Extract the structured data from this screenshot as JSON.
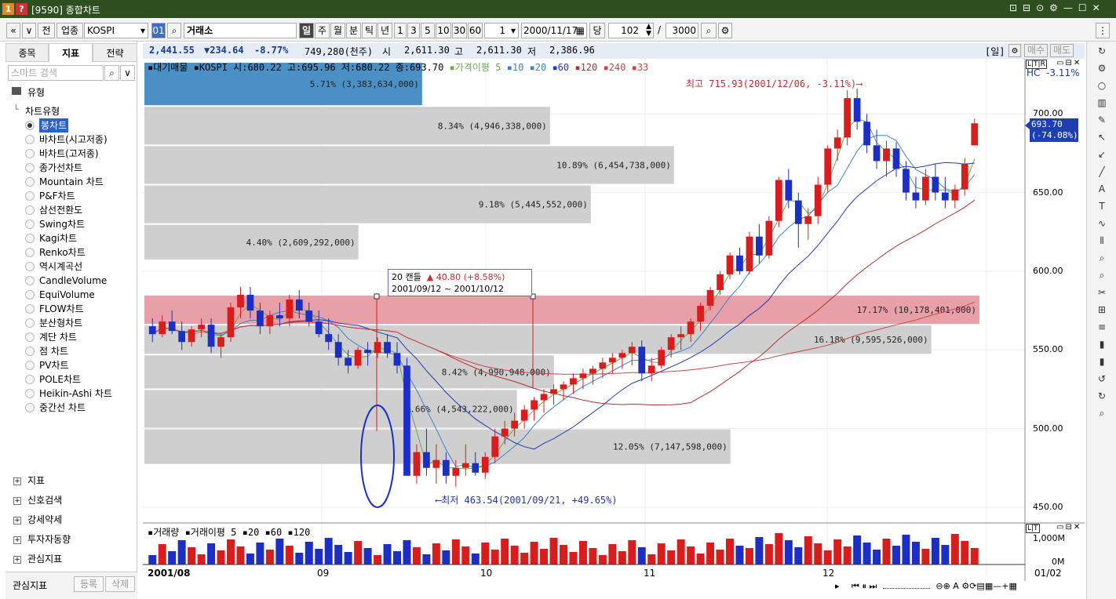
{
  "window": {
    "title": "[9590] 종합차트",
    "icons": [
      "1",
      "?"
    ]
  },
  "toolbar": {
    "nav_prev": "«",
    "nav_down": "»",
    "jeon": "전",
    "category": "업종",
    "symbol": "KOSPI",
    "code": "01",
    "market": "거래소",
    "periods": [
      "일",
      "주",
      "월",
      "분",
      "틱",
      "년"
    ],
    "active_period": "일",
    "intervals": [
      "1",
      "3",
      "5",
      "10",
      "30",
      "60"
    ],
    "count_select": "1",
    "date": "2000/11/17",
    "dang": "당",
    "bars": "102",
    "slash": "/",
    "total": "3000"
  },
  "left_tabs": [
    "종목",
    "지표",
    "전략"
  ],
  "active_left_tab": "지표",
  "search_placeholder": "스마트 검색",
  "tree": {
    "root": "유형",
    "group": "차트유형",
    "items": [
      "봉차트",
      "바차트(시고저종)",
      "바차트(고저종)",
      "종가선차트",
      "Mountain 차트",
      "P&F차트",
      "삼선전환도",
      "Swing차트",
      "Kagi차트",
      "Renko차트",
      "역시계곡선",
      "CandleVolume",
      "EquiVolume",
      "FLOW차트",
      "분산형차트",
      "계단 차트",
      "점 차트",
      "PV차트",
      "POLE차트",
      "Heikin-Ashi 차트",
      "중간선 차트"
    ],
    "selected": "봉차트"
  },
  "sections": [
    "지표",
    "신호검색",
    "강세약세",
    "투자자동향",
    "관심지표"
  ],
  "bottom_left": {
    "label": "관심지표",
    "register": "등록",
    "delete": "삭제"
  },
  "infobar": {
    "price": "2,441.55",
    "change": "▼234.64",
    "pct": "-8.77%",
    "volume": "749,280(천주)",
    "open_label": "시",
    "open": "2,611.30",
    "high_label": "고",
    "high": "2,611.30",
    "low_label": "저",
    "low": "2,386.96",
    "period_tag": "[일]",
    "buy": "매수",
    "sell": "매도"
  },
  "legend": {
    "main": "▪대기매물 ▪KOSPI 시:680.22 고:695.96 저:680.22 종:693.70",
    "ma_label": "▪가격이평 5",
    "ma_items": [
      "10",
      "20",
      "60",
      "120",
      "240",
      "33"
    ],
    "ma_colors": [
      "#6aa84f",
      "#3d85c6",
      "#3d85c6",
      "#1f3bb3",
      "#b03030",
      "#cc4444",
      "#cc4444"
    ]
  },
  "price_axis": {
    "labels": [
      "700.00",
      "650.00",
      "600.00",
      "550.00",
      "500.00",
      "450.00"
    ],
    "hc": "HC",
    "hc_pct": "-3.11%",
    "current": "693.70",
    "current_pct": "(-74.08%)"
  },
  "annotations": {
    "high": "최고 715.93(2001/12/06, -3.11%)⟶",
    "low": "⟵최저 463.54(2001/09/21, +49.65%)",
    "box_line1": "20 캔들",
    "box_change": "▲ 40.80 (+8.58%)",
    "box_line2": "2001/09/12 ~ 2001/10/12"
  },
  "chart_data": {
    "type": "volume_profile_candlestick",
    "profile": [
      {
        "label": "5.71% (3,383,634,000)",
        "pct": 5.71
      },
      {
        "label": "8.34% (4,946,338,000)",
        "pct": 8.34
      },
      {
        "label": "10.89% (6,454,738,000)",
        "pct": 10.89
      },
      {
        "label": "9.18% (5,445,552,000)",
        "pct": 9.18
      },
      {
        "label": "4.40% (2,609,292,000)",
        "pct": 4.4
      },
      {
        "label": "17.17% (10,178,401,000)",
        "pct": 17.17
      },
      {
        "label": "16.18% (9,595,526,000)",
        "pct": 16.18
      },
      {
        "label": "8.42% (4,990,948,000)",
        "pct": 8.42
      },
      {
        "label": "7.66% (4,543,222,000)",
        "pct": 7.66
      },
      {
        "label": "12.05% (7,147,598,000)",
        "pct": 12.05
      }
    ],
    "ylim": [
      450,
      720
    ],
    "x_labels": [
      "2001/08",
      "09",
      "10",
      "11",
      "12",
      "01/02"
    ],
    "candles": [
      [
        565,
        570,
        555,
        560
      ],
      [
        560,
        572,
        558,
        568
      ],
      [
        568,
        575,
        560,
        562
      ],
      [
        562,
        568,
        550,
        555
      ],
      [
        555,
        565,
        552,
        563
      ],
      [
        563,
        570,
        558,
        566
      ],
      [
        566,
        570,
        548,
        552
      ],
      [
        552,
        560,
        545,
        558
      ],
      [
        558,
        580,
        555,
        577
      ],
      [
        577,
        590,
        570,
        585
      ],
      [
        585,
        590,
        570,
        575
      ],
      [
        575,
        580,
        560,
        565
      ],
      [
        565,
        575,
        560,
        572
      ],
      [
        572,
        580,
        565,
        570
      ],
      [
        570,
        585,
        565,
        582
      ],
      [
        582,
        588,
        570,
        575
      ],
      [
        575,
        580,
        565,
        568
      ],
      [
        568,
        575,
        558,
        560
      ],
      [
        560,
        570,
        550,
        555
      ],
      [
        555,
        560,
        540,
        545
      ],
      [
        545,
        550,
        535,
        540
      ],
      [
        540,
        552,
        538,
        550
      ],
      [
        550,
        555,
        540,
        548
      ],
      [
        548,
        558,
        545,
        555
      ],
      [
        555,
        560,
        545,
        548
      ],
      [
        548,
        555,
        535,
        540
      ],
      [
        540,
        545,
        480,
        470
      ],
      [
        470,
        490,
        465,
        485
      ],
      [
        485,
        500,
        470,
        475
      ],
      [
        475,
        490,
        465,
        480
      ],
      [
        480,
        485,
        465,
        470
      ],
      [
        470,
        480,
        463,
        475
      ],
      [
        475,
        490,
        470,
        478
      ],
      [
        478,
        485,
        470,
        472
      ],
      [
        472,
        485,
        468,
        482
      ],
      [
        482,
        500,
        478,
        495
      ],
      [
        495,
        505,
        490,
        500
      ],
      [
        500,
        510,
        495,
        505
      ],
      [
        505,
        515,
        500,
        512
      ],
      [
        512,
        520,
        505,
        518
      ],
      [
        518,
        525,
        510,
        522
      ],
      [
        522,
        528,
        515,
        525
      ],
      [
        525,
        530,
        518,
        528
      ],
      [
        528,
        535,
        522,
        532
      ],
      [
        532,
        538,
        525,
        535
      ],
      [
        535,
        540,
        528,
        538
      ],
      [
        538,
        545,
        532,
        542
      ],
      [
        542,
        548,
        535,
        545
      ],
      [
        545,
        550,
        538,
        548
      ],
      [
        548,
        555,
        540,
        552
      ],
      [
        552,
        556,
        530,
        535
      ],
      [
        535,
        545,
        530,
        540
      ],
      [
        540,
        552,
        538,
        550
      ],
      [
        550,
        560,
        545,
        558
      ],
      [
        558,
        565,
        550,
        560
      ],
      [
        560,
        570,
        555,
        568
      ],
      [
        568,
        580,
        562,
        578
      ],
      [
        578,
        590,
        575,
        588
      ],
      [
        588,
        600,
        585,
        598
      ],
      [
        598,
        612,
        595,
        610
      ],
      [
        610,
        615,
        598,
        600
      ],
      [
        600,
        625,
        598,
        622
      ],
      [
        622,
        630,
        605,
        610
      ],
      [
        610,
        635,
        608,
        632
      ],
      [
        632,
        660,
        628,
        658
      ],
      [
        658,
        665,
        640,
        645
      ],
      [
        645,
        650,
        615,
        630
      ],
      [
        630,
        640,
        620,
        635
      ],
      [
        635,
        660,
        630,
        655
      ],
      [
        655,
        680,
        650,
        678
      ],
      [
        678,
        690,
        670,
        685
      ],
      [
        685,
        715,
        680,
        710
      ],
      [
        710,
        716,
        690,
        695
      ],
      [
        695,
        700,
        675,
        680
      ],
      [
        680,
        690,
        665,
        670
      ],
      [
        670,
        683,
        660,
        678
      ],
      [
        678,
        682,
        660,
        665
      ],
      [
        665,
        670,
        645,
        650
      ],
      [
        650,
        660,
        640,
        645
      ],
      [
        645,
        665,
        642,
        660
      ],
      [
        660,
        668,
        645,
        650
      ],
      [
        650,
        660,
        640,
        645
      ],
      [
        645,
        655,
        640,
        652
      ],
      [
        652,
        672,
        648,
        668
      ],
      [
        680,
        697,
        680,
        694
      ]
    ]
  },
  "volume_panel": {
    "legend": "▪거래량 ▪거래이평 5 ▪20 ▪60 ▪120",
    "scale_top": "1,000M",
    "scale_bottom": "0M"
  },
  "statusbar": {
    "left_label": "2001/08"
  }
}
